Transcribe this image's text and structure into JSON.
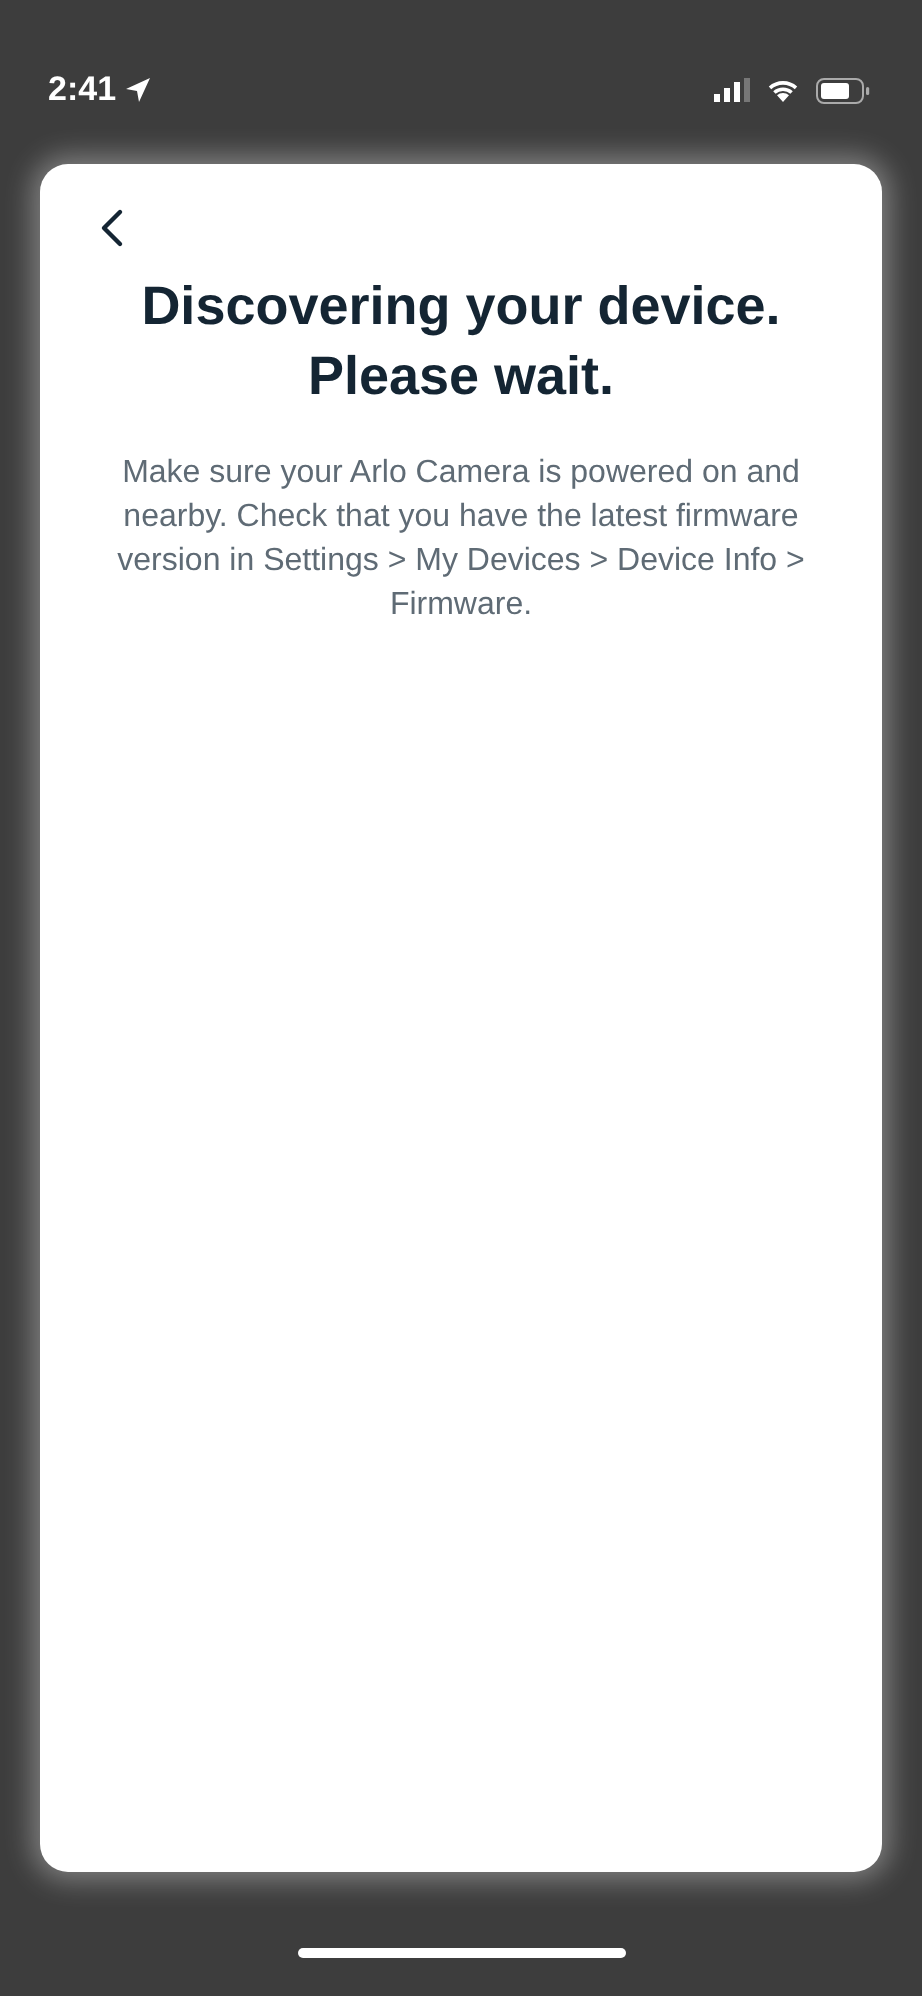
{
  "status_bar": {
    "time": "2:41"
  },
  "screen": {
    "title": "Discovering your device. Please wait.",
    "message": "Make sure your Arlo Camera is powered on and nearby. Check that you have the latest firmware version in Settings > My Devices > Device Info > Firmware."
  }
}
